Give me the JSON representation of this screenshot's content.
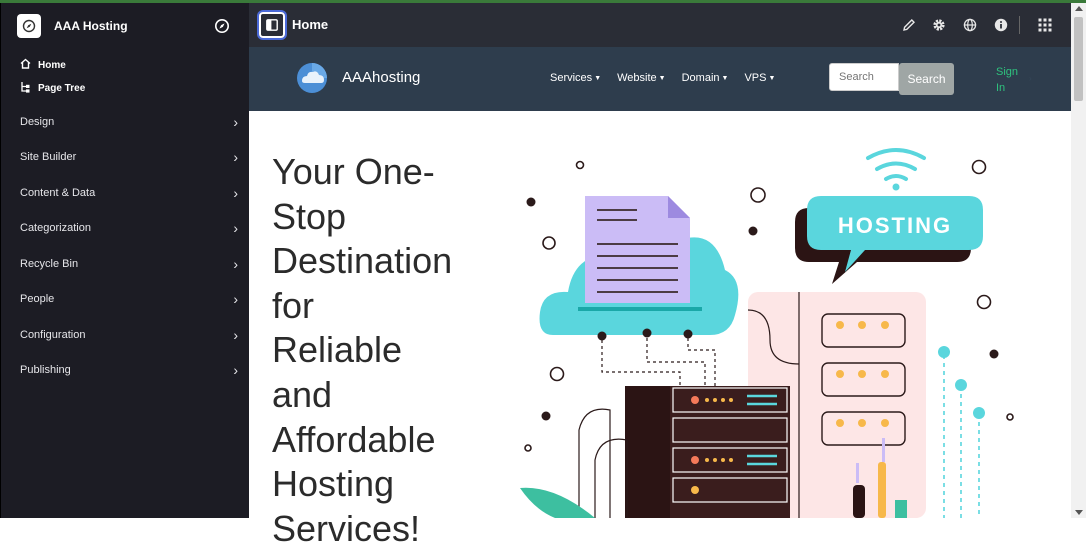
{
  "site": {
    "name": "AAA Hosting"
  },
  "sidebar": {
    "top_items": [
      {
        "label": "Home",
        "icon": "home-icon"
      },
      {
        "label": "Page Tree",
        "icon": "page-tree-icon"
      }
    ],
    "items": [
      {
        "label": "Design"
      },
      {
        "label": "Site Builder"
      },
      {
        "label": "Content & Data"
      },
      {
        "label": "Categorization"
      },
      {
        "label": "Recycle Bin"
      },
      {
        "label": "People"
      },
      {
        "label": "Configuration"
      },
      {
        "label": "Publishing"
      }
    ]
  },
  "topbar": {
    "title": "Home",
    "icons": [
      "pencil-icon",
      "gear-icon",
      "globe-icon",
      "info-icon",
      "apps-grid-icon"
    ]
  },
  "sitenav": {
    "brand": "AAAhosting",
    "links": [
      {
        "label": "Services"
      },
      {
        "label": "Website"
      },
      {
        "label": "Domain"
      },
      {
        "label": "VPS"
      }
    ],
    "search_placeholder": "Search",
    "search_button": "Search",
    "signin": "Sign In"
  },
  "hero": {
    "headline_lines": [
      "Your One-",
      "Stop",
      "Destination",
      "for",
      "Reliable",
      "and",
      "Affordable",
      "Hosting",
      "Services!"
    ],
    "badge_text": "HOSTING"
  },
  "colors": {
    "sidebar_bg": "#1c1c24",
    "topbar_bg": "#2a2d36",
    "sitenav_bg": "#2e3d4d",
    "accent_teal": "#5ad6dd",
    "signin_green": "#2ec27e"
  }
}
